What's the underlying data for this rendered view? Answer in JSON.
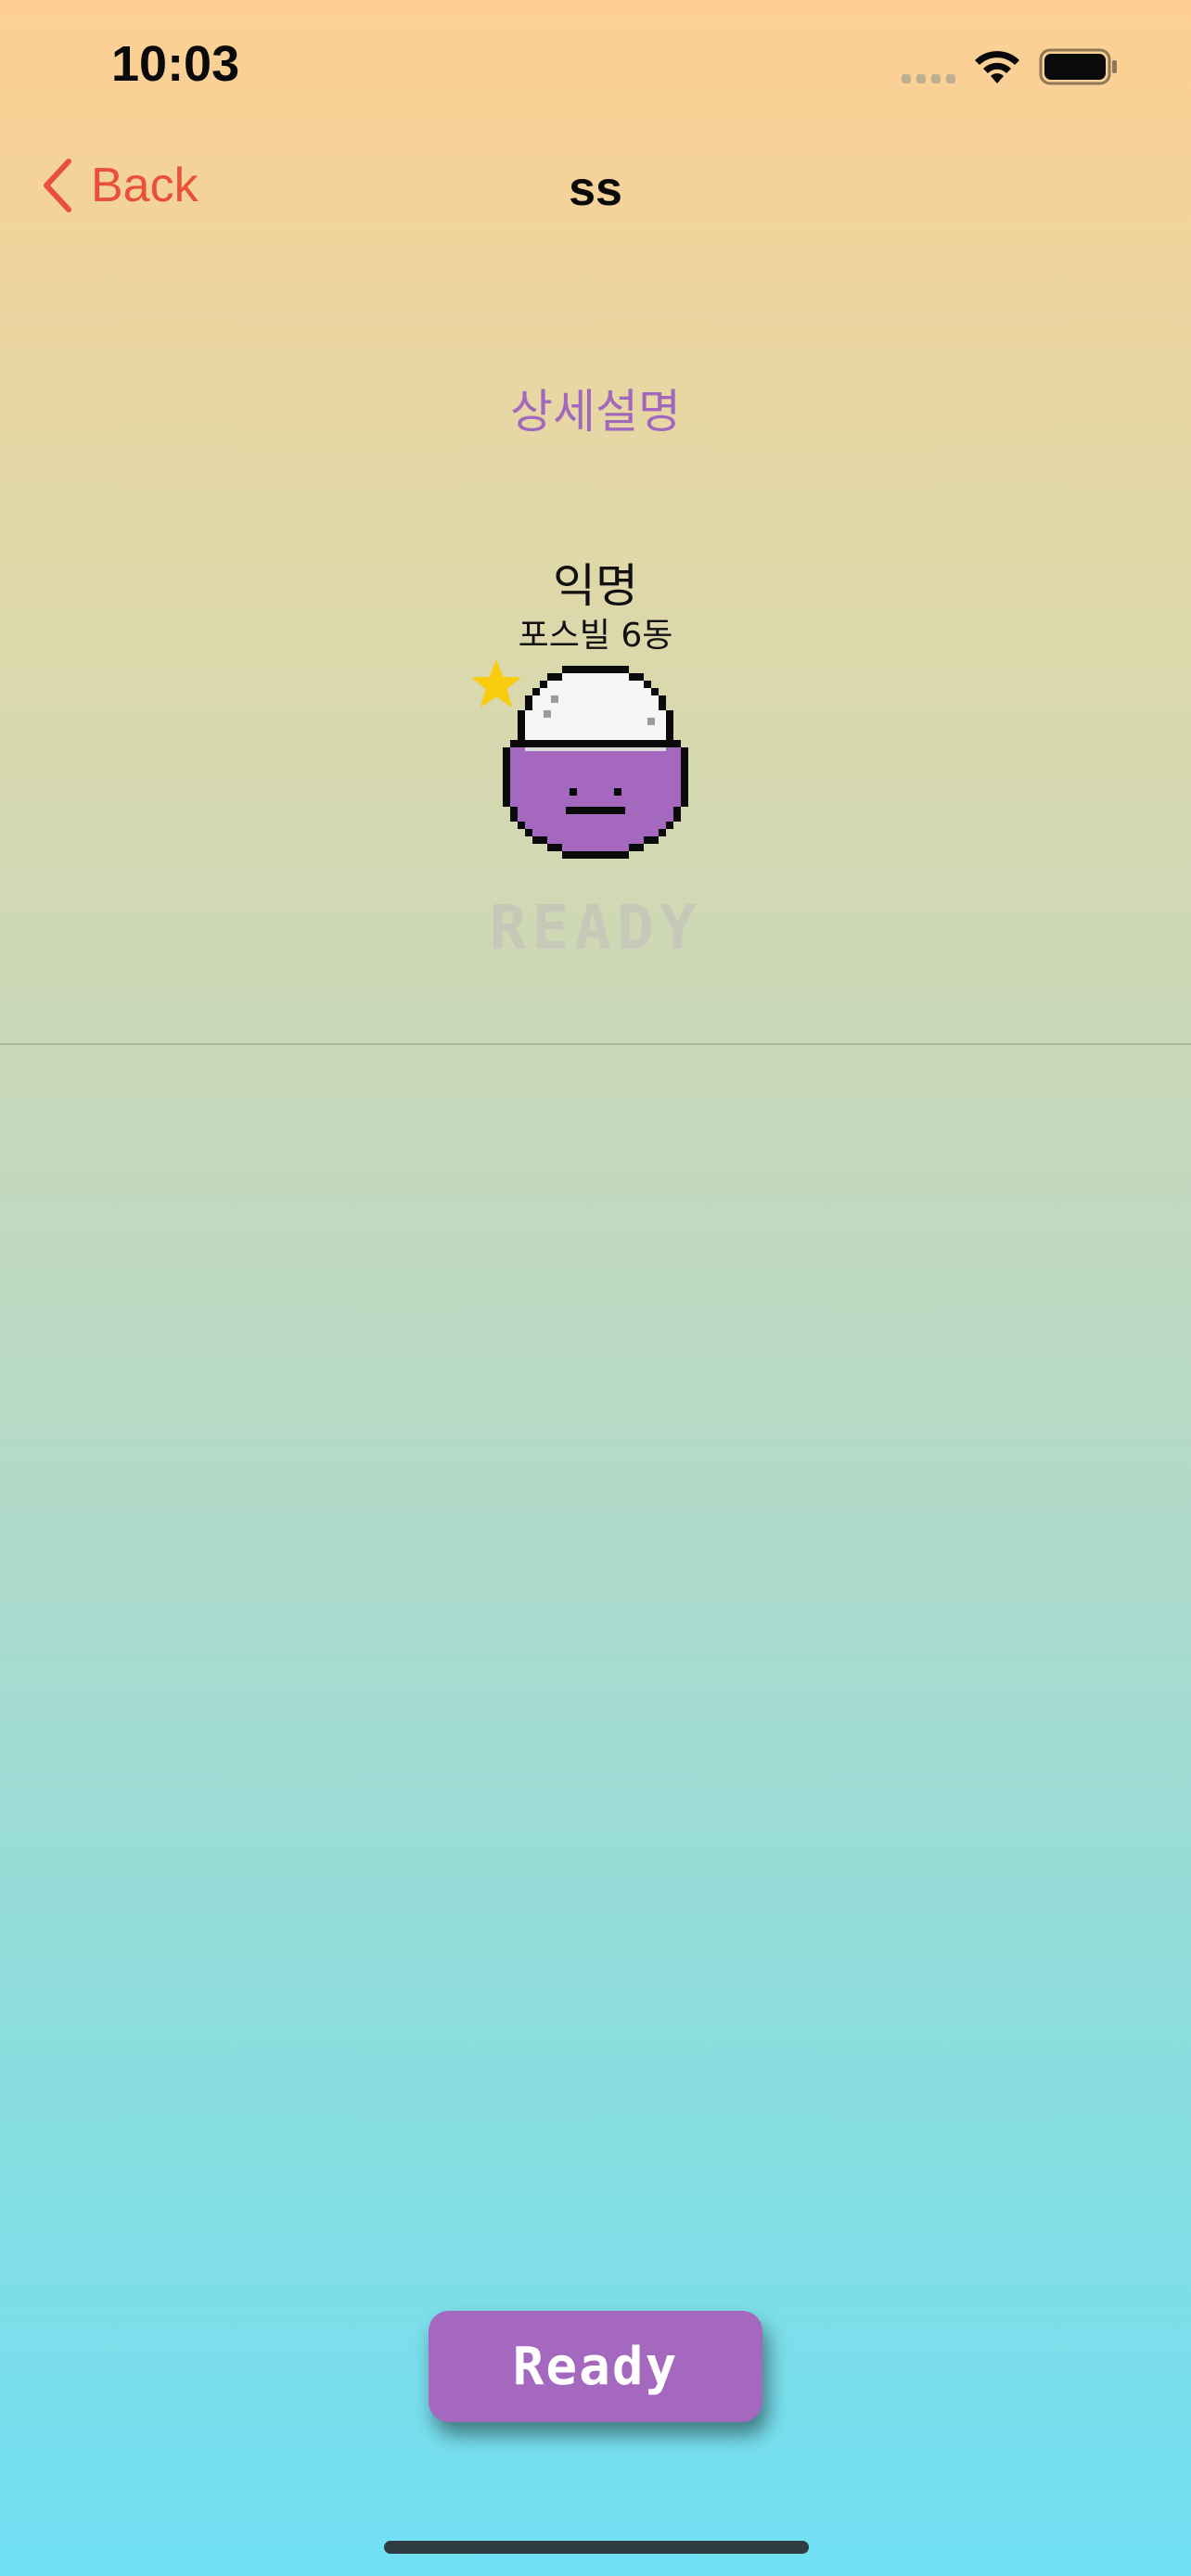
{
  "status_bar": {
    "time": "10:03"
  },
  "nav": {
    "back_label": "Back",
    "title": "ss"
  },
  "detail": {
    "description_link": "상세설명",
    "name": "익명",
    "location": "포스빌 6동",
    "status_text": "READY"
  },
  "actions": {
    "ready_button_label": "Ready"
  },
  "colors": {
    "accent_red": "#E8503A",
    "accent_purple": "#A468BE",
    "star_yellow": "#F9CC0F",
    "gradient_top": "#FECF92",
    "gradient_bottom": "#70E0F4"
  },
  "icons": {
    "back": "chevron-left-icon",
    "wifi": "wifi-icon",
    "battery": "battery-icon",
    "signal": "signal-icon",
    "star": "star-icon",
    "avatar": "pixel-rice-ball-avatar"
  }
}
